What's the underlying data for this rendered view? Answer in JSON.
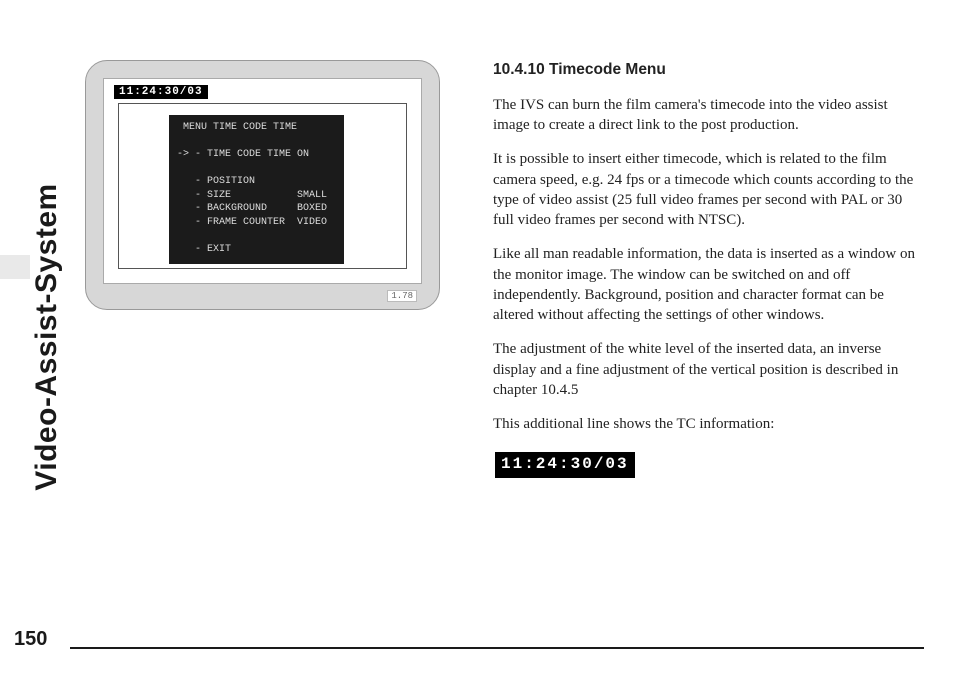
{
  "side_tab": {
    "label": "Video-Assist-System"
  },
  "page_number": "150",
  "figure": {
    "timecode_top": "11:24:30/03",
    "menu": {
      "title": " MENU TIME CODE TIME",
      "cursor": "-> - TIME CODE TIME ON",
      "row_position": "   - POSITION",
      "row_size": "   - SIZE           SMALL",
      "row_background": "   - BACKGROUND     BOXED",
      "row_framectr": "   - FRAME COUNTER  VIDEO",
      "row_exit": "   - EXIT"
    },
    "version_tag": "1.78"
  },
  "article": {
    "heading": "10.4.10 Timecode Menu",
    "p1": "The IVS can burn the film camera's timecode into the video assist image to create a direct link to the post production.",
    "p2": "It is possible to insert either timecode, which is related to the film camera speed, e.g. 24 fps or a timecode which counts according to the type of video assist (25 full video frames per second with PAL or 30 full video frames per second with NTSC).",
    "p3": "Like all man readable information, the data is inserted as a window on the monitor image. The window can be switched on and off independently. Background, position and character format can be altered without affecting the settings of other windows.",
    "p4": "The adjustment of the white level of the inserted data, an inverse display and a fine adjustment of the vertical position is described in chapter 10.4.5",
    "p5": "This additional line shows the TC information:",
    "tc_example": "11:24:30/03"
  }
}
